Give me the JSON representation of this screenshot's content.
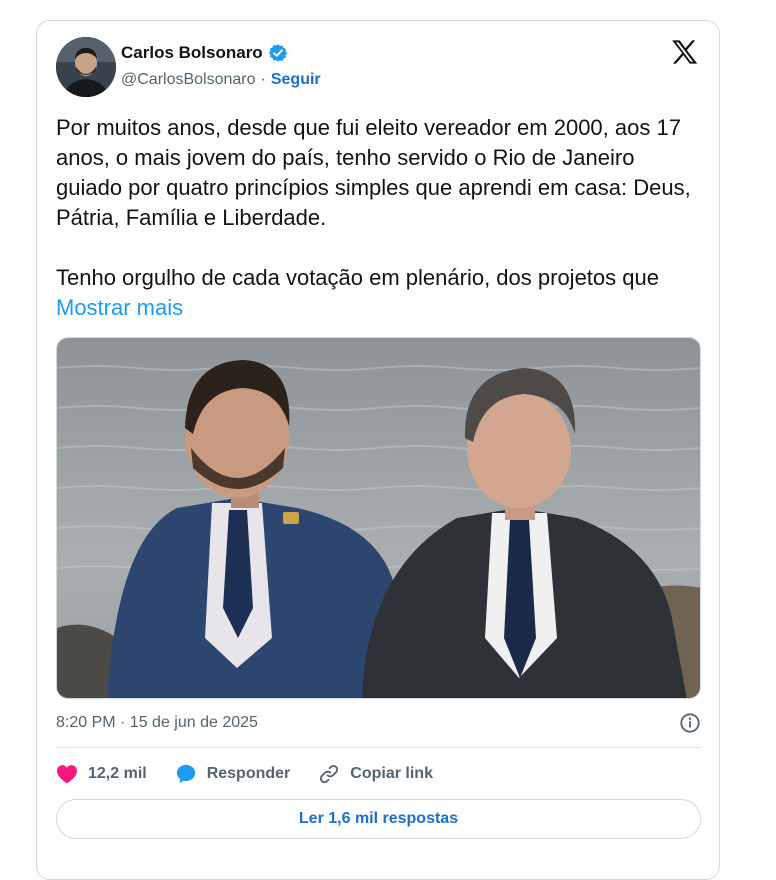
{
  "author": {
    "name": "Carlos Bolsonaro",
    "handle": "@CarlosBolsonaro",
    "separator": "·",
    "follow_label": "Seguir",
    "verified": true
  },
  "tweet": {
    "text": "Por muitos anos, desde que fui eleito vereador em 2000, aos 17 anos, o mais jovem do país, tenho servido o Rio de Janeiro guiado por quatro princípios simples que aprendi em casa: Deus, Pátria, Família e Liberdade.\n\nTenho orgulho de cada votação em plenário, dos projetos que ",
    "show_more_label": "Mostrar mais",
    "timestamp": "8:20 PM · 15 de jun de 2025"
  },
  "actions": {
    "likes": "12,2 mil",
    "reply_label": "Responder",
    "copy_link_label": "Copiar link"
  },
  "read_replies_label": "Ler 1,6 mil respostas",
  "colors": {
    "accent": "#1d9bf0",
    "like": "#f91880",
    "verified": "#1d9bf0",
    "text": "#0f1419",
    "secondary": "#536471"
  },
  "icons": {
    "verified": "verified-badge-icon",
    "brand": "x-logo-icon",
    "info": "info-icon",
    "like": "heart-icon",
    "reply": "speech-bubble-icon",
    "link": "link-icon"
  }
}
